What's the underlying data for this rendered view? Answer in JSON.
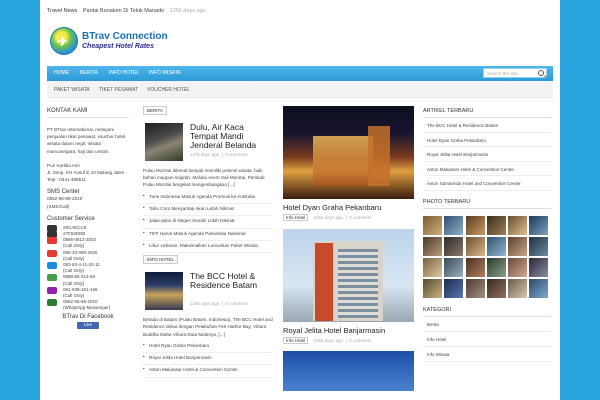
{
  "topbar": {
    "label": "Travel News",
    "headline": "Pantai Bunaken Di Teluk Manado",
    "ago": "1256 days ago"
  },
  "logo": {
    "title": "BTrav Connection",
    "subtitle": "Cheapest Hotel Rates"
  },
  "nav_primary": [
    "HOME",
    "BERITA",
    "INFO HOTEL",
    "INFO WISATA"
  ],
  "search": {
    "placeholder": "Search this site..."
  },
  "nav_secondary": [
    "PAKET WISATA",
    "TIKET PESAWAT",
    "VOUCHER HOTEL"
  ],
  "left": {
    "kontak_title": "KONTAK KAMI",
    "kontak_text": "PT BTrav International, melayani penjualan tiket pesawat, voucher hotel, wisata dalam negri, wisata mancanegara, haji dan umrah.",
    "address": "Puri Kartika Asri\nJl. Simp. KH.Yusuf E 10 Malang Jatim\nTelp : 0341-488511",
    "sms_title": "SMS Center",
    "sms_text": "0852-55-88-2010\n(SMS/Call)",
    "cs_title": "Customer Service",
    "cs_items": [
      {
        "icon": "bbm-icon",
        "text": "29CAECC6",
        "color": "#333333"
      },
      {
        "icon": "bbm-icon",
        "text": "27F63DDB",
        "color": "#333333"
      },
      {
        "icon": "phone-icon",
        "text": "0856-0812-2002",
        "color": "#e53935"
      },
      {
        "icon": "phone-icon",
        "text": "(Call Only)",
        "color": ""
      },
      {
        "icon": "phone-icon",
        "text": "085-33-060-2626",
        "color": "#e53935"
      },
      {
        "icon": "phone-icon",
        "text": "(Call Only)",
        "color": ""
      },
      {
        "icon": "phone-icon",
        "text": "083-83-4-11-22-11",
        "color": "#1e88e5"
      },
      {
        "icon": "phone-icon",
        "text": "(Call Only)",
        "color": ""
      },
      {
        "icon": "phone-icon",
        "text": "0888-55-313-58",
        "color": "#43a047"
      },
      {
        "icon": "phone-icon",
        "text": "(Call Only)",
        "color": ""
      },
      {
        "icon": "phone-icon",
        "text": "081-939-161-166",
        "color": "#8e24aa"
      },
      {
        "icon": "phone-icon",
        "text": "(Call Only)",
        "color": ""
      },
      {
        "icon": "whatsapp-icon",
        "text": "0852-55-88-2010",
        "color": "#2e7d32"
      },
      {
        "icon": "whatsapp-icon",
        "text": "(WhatsApp Messenger)",
        "color": ""
      }
    ],
    "fb_title": "BTrav Di Facebook",
    "fb_like": "Like"
  },
  "mid": {
    "tag1": "BERITA",
    "post1": {
      "title": "Dulu, Air Kaca Tempat Mandi Jenderal Belanda",
      "meta": "1176 days ago",
      "comments": "0 comment"
    },
    "excerpt1": "Pulau Morotai dikenal banyak memiliki potensi wisata, baik bahari maupun sejarah. Melalui event Sail Morotai, Pemkab Pulau Morotai bergeliat mengembangkan [...]",
    "list1": [
      "Turis Indonesia Masuk Agenda Promosi ke Australia",
      "Tahu Coro Menyantap Akan Lebih Nikmat",
      "Jalan-jalan di Negeri Sendiri Lebih Nikmat",
      "TIFF Harus Masuk Agenda Pariwisata Nasional",
      "Libur Lebaran, Maksimalkan Luncurkan Paket Wisata"
    ],
    "tag2": "INFO HOTEL",
    "post2": {
      "title": "The BCC Hotel & Residence Batam",
      "meta": "1169 days ago",
      "comments": "0 comment"
    },
    "excerpt2": "Berada di Batam (Pulau Batam, Indonesia), The BCC Hotel and Residence dekat dengan Pelabuhan Feri Harbor Bay, Vihara Buddha Maha Vihara Duta Maitreya, [...]",
    "list2": [
      "Hotel Dyan Graha Pekanbaru",
      "Royal Jelita Hotel Banjarmasin",
      "Aston Makassar Hotel & Convention Center"
    ]
  },
  "big": [
    {
      "title": "Hotel Dyan Graha Pekanbaru",
      "tag": "Info Hotel",
      "meta": "1062 days ago",
      "comments": "0 comment"
    },
    {
      "title": "Royal Jelita Hotel Banjarmasin",
      "tag": "Info Hotel",
      "meta": "1062 days ago",
      "comments": "0 comment"
    }
  ],
  "right": {
    "artikel_title": "ARTIKEL TERBARU",
    "artikel": [
      "The BCC Hotel & Residence Batam",
      "Hotel Dyan Graha Pekanbaru",
      "Royal Jelita Hotel Banjarmasin",
      "Aston Makassar Hotel & Convention Center",
      "Aston Samarinda Hotel and Convention Center"
    ],
    "foto_title": "PHOTO TERBARU",
    "kategori_title": "KATEGORI",
    "kategori": [
      "Berita",
      "Info Hotel",
      "Info Wisata"
    ]
  },
  "colors": {
    "accent": "#29a6e0",
    "nav": "#2a9ad8"
  }
}
